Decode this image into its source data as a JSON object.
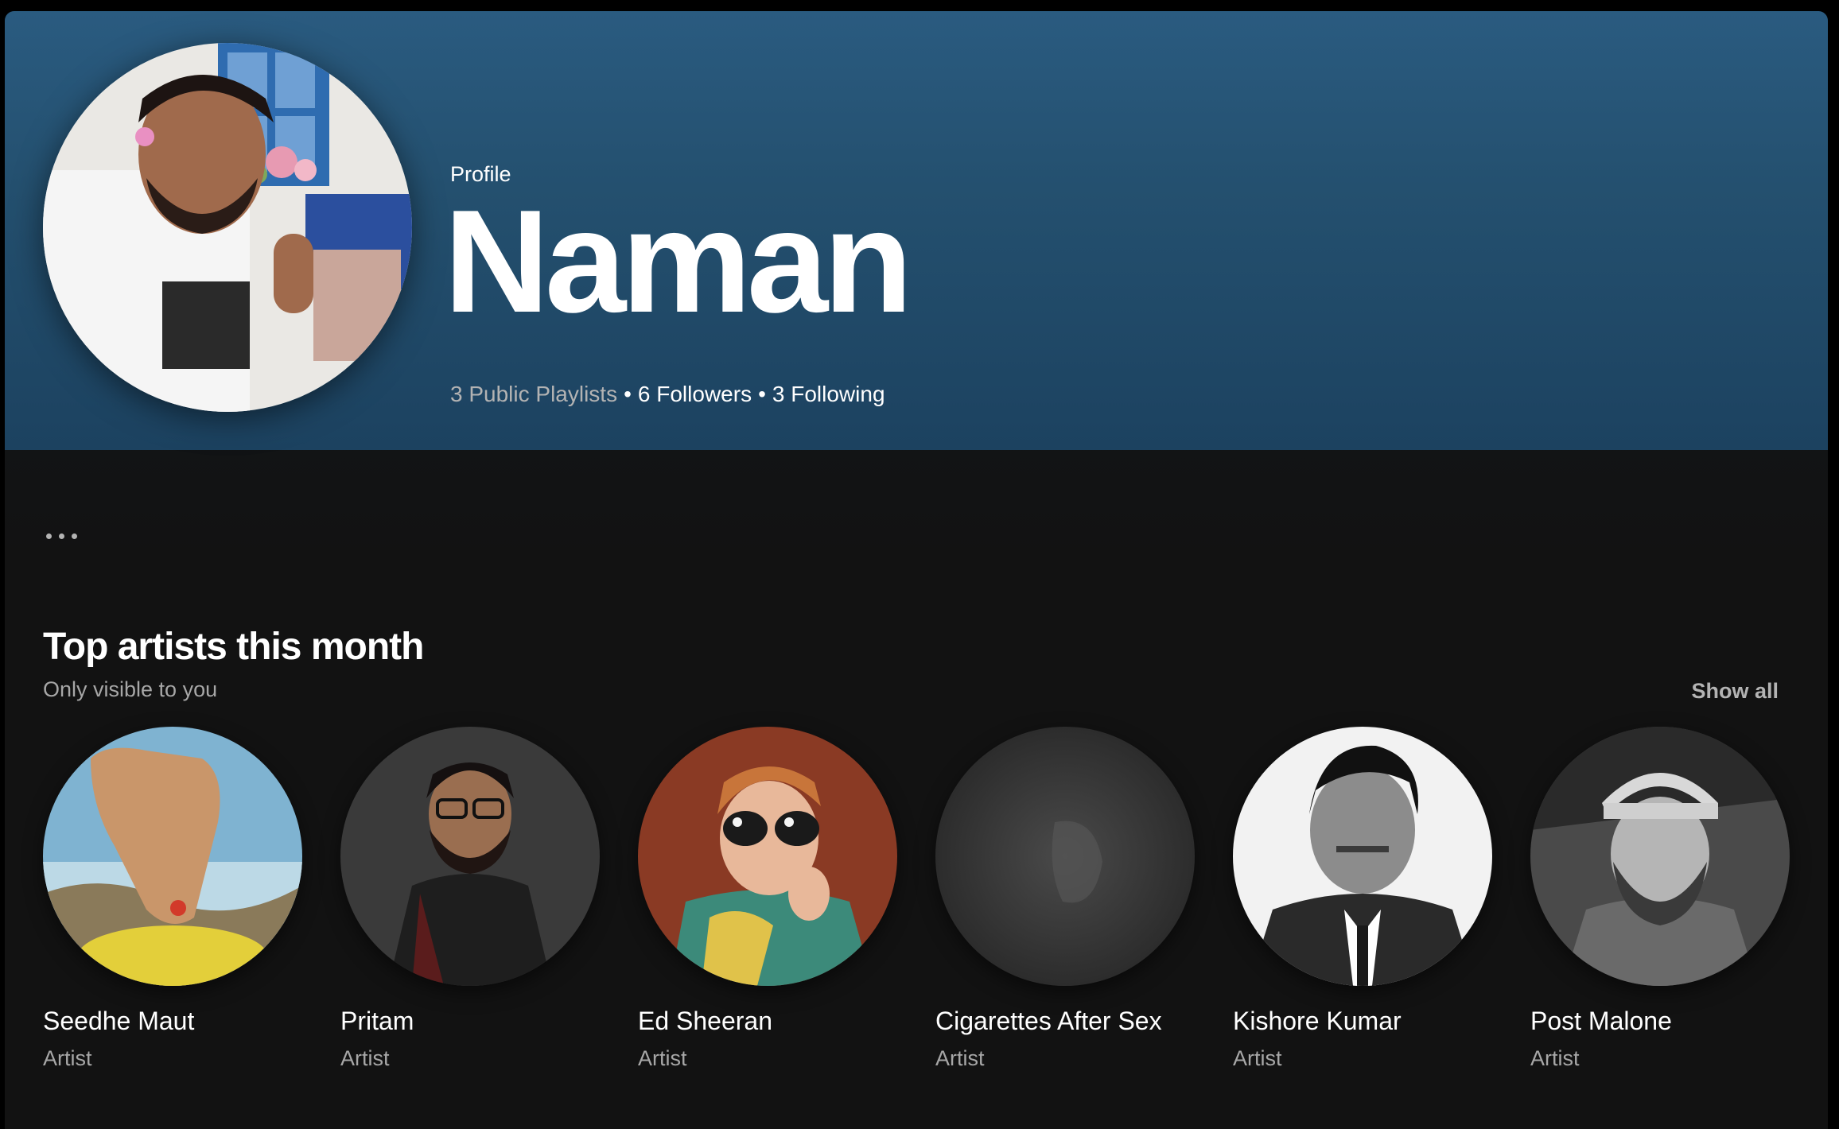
{
  "profile": {
    "kind_label": "Profile",
    "name": "Naman",
    "stats": {
      "playlists": "3 Public Playlists",
      "followers": "6 Followers",
      "following": "3 Following",
      "separator": "•"
    }
  },
  "actions": {
    "more_icon": "more-options-icon"
  },
  "top_artists": {
    "title": "Top artists this month",
    "subtitle": "Only visible to you",
    "show_all": "Show all",
    "items": [
      {
        "name": "Seedhe Maut",
        "kind": "Artist"
      },
      {
        "name": "Pritam",
        "kind": "Artist"
      },
      {
        "name": "Ed Sheeran",
        "kind": "Artist"
      },
      {
        "name": "Cigarettes After Sex",
        "kind": "Artist"
      },
      {
        "name": "Kishore Kumar",
        "kind": "Artist"
      },
      {
        "name": "Post Malone",
        "kind": "Artist"
      }
    ]
  },
  "colors": {
    "hero_top": "#2a5b80",
    "background": "#121212",
    "text_primary": "#ffffff",
    "text_secondary": "#a7a7a7"
  }
}
